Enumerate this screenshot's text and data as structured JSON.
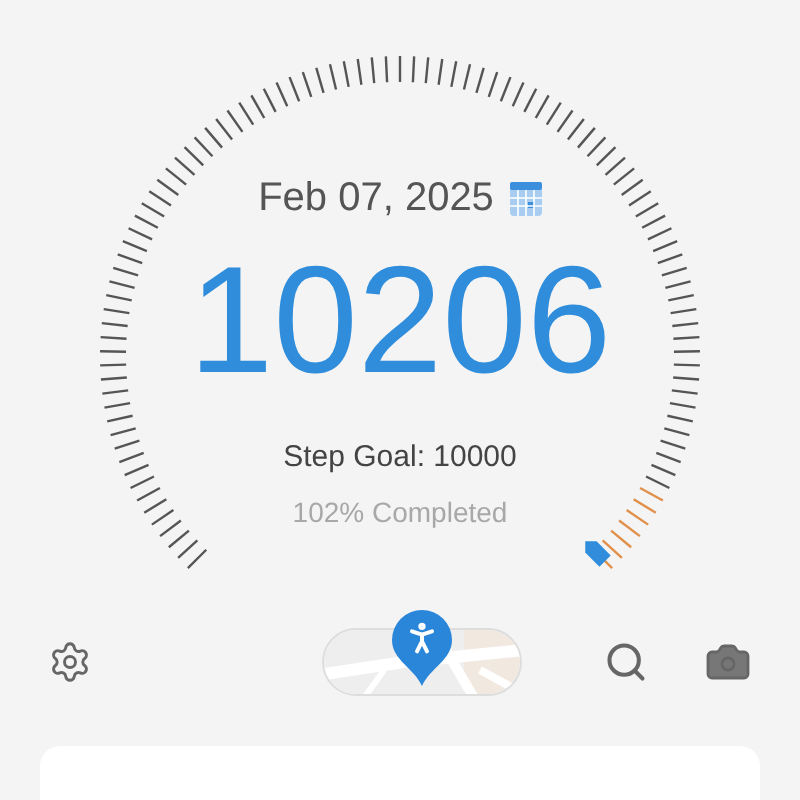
{
  "date": "Feb 07, 2025",
  "steps": "10206",
  "goal_text": "Step Goal: 10000",
  "completion": "102% Completed"
}
